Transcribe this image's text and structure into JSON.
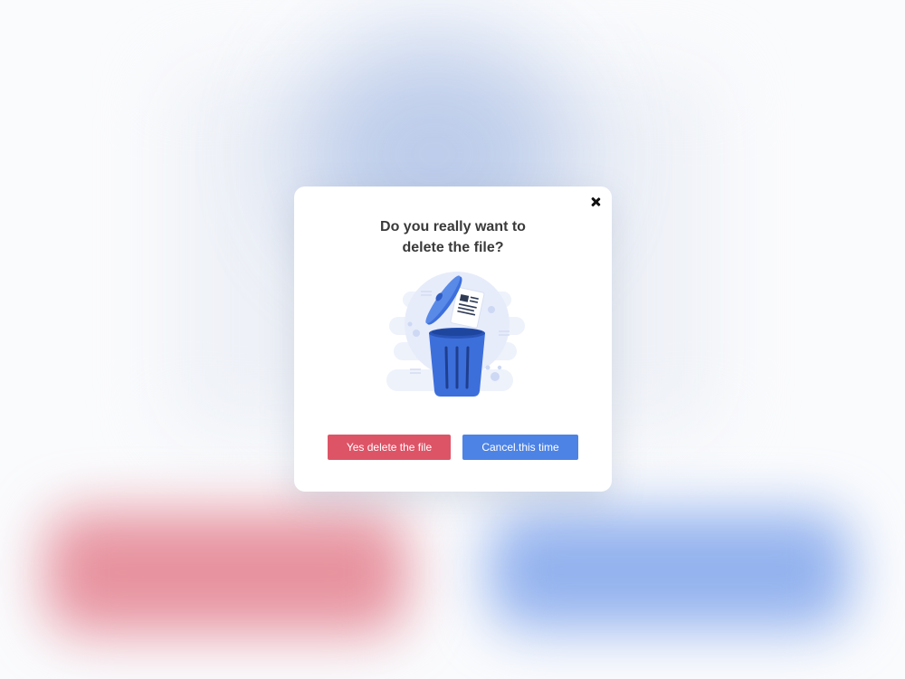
{
  "dialog": {
    "title_line1": "Do you really want to",
    "title_line2": "delete the file?",
    "confirm_label": "Yes delete the file",
    "cancel_label": "Cancel.this time",
    "close_icon": "close-icon",
    "illustration_icon": "trash-bin-with-document-icon"
  },
  "colors": {
    "danger": "#dd5467",
    "primary": "#4d83e4",
    "illustration_blue": "#3d6fdb",
    "title_text": "#3a3a3a"
  }
}
